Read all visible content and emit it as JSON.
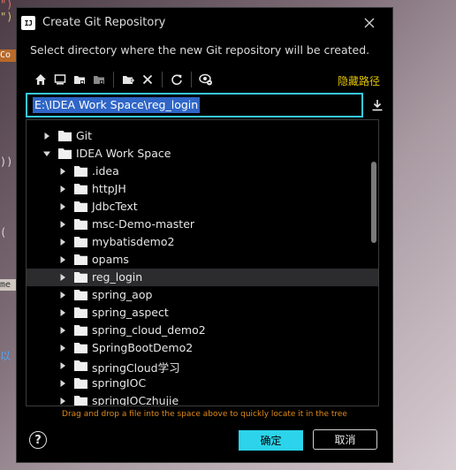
{
  "dialog": {
    "title": "Create Git Repository",
    "app_icon_text": "IJ",
    "subtitle": "Select directory where the new Git repository will be created.",
    "hide_path_label": "隐藏路径",
    "path_value": "E:\\IDEA Work Space\\reg_login",
    "drop_hint": "Drag and drop a file into the space above to quickly locate it in the tree",
    "help_label": "?",
    "ok_label": "确定",
    "cancel_label": "取消"
  },
  "toolbar": {
    "icons": [
      "home-icon",
      "desktop-icon",
      "project-folder-icon",
      "module-folder-icon",
      "new-folder-icon",
      "delete-icon",
      "refresh-icon",
      "show-hidden-icon"
    ]
  },
  "tree": {
    "items": [
      {
        "label": "Git",
        "level": 0,
        "expanded": false
      },
      {
        "label": "IDEA Work Space",
        "level": 0,
        "expanded": true
      },
      {
        "label": ".idea",
        "level": 1,
        "expanded": false
      },
      {
        "label": "httpJH",
        "level": 1,
        "expanded": false
      },
      {
        "label": "JdbcText",
        "level": 1,
        "expanded": false
      },
      {
        "label": "msc-Demo-master",
        "level": 1,
        "expanded": false
      },
      {
        "label": "mybatisdemo2",
        "level": 1,
        "expanded": false
      },
      {
        "label": "opams",
        "level": 1,
        "expanded": false
      },
      {
        "label": "reg_login",
        "level": 1,
        "expanded": false,
        "selected": true
      },
      {
        "label": "spring_aop",
        "level": 1,
        "expanded": false
      },
      {
        "label": "spring_aspect",
        "level": 1,
        "expanded": false
      },
      {
        "label": "spring_cloud_demo2",
        "level": 1,
        "expanded": false
      },
      {
        "label": "SpringBootDemo2",
        "level": 1,
        "expanded": false
      },
      {
        "label": "springCloud学习",
        "level": 1,
        "expanded": false
      },
      {
        "label": "springIOC",
        "level": 1,
        "expanded": false
      },
      {
        "label": "springIOCzhujie",
        "level": 1,
        "expanded": false
      }
    ]
  },
  "backdrop": {
    "fragments": [
      "\")",
      "\")",
      "Co",
      "))",
      "(",
      "me",
      "以"
    ]
  },
  "colors": {
    "accent": "#2bd4ea",
    "input_border": "#35c8e6",
    "selection": "#2f66c7",
    "hide_path": "#e0c200",
    "hint": "#e08a1a"
  }
}
